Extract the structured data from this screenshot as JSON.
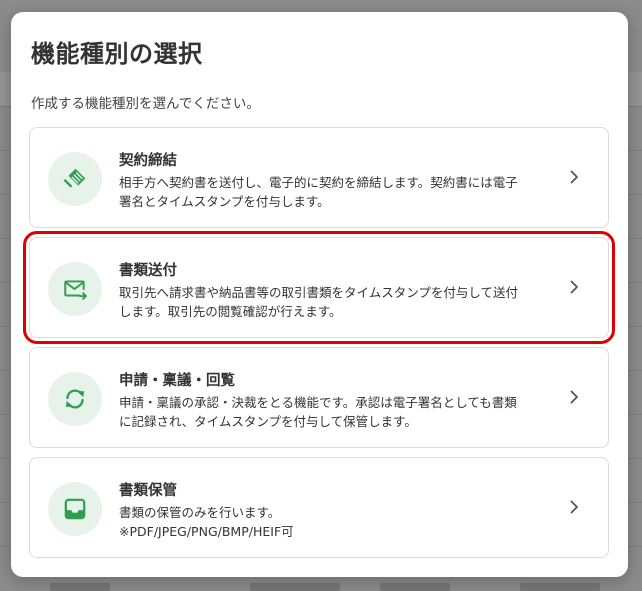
{
  "modal": {
    "title": "機能種別の選択",
    "subtitle": "作成する機能種別を選んでください。"
  },
  "options": [
    {
      "title": "契約締結",
      "desc_line1": "相手方へ契約書を送付し、電子的に契約を締結します。契約書には電子",
      "desc_line2": "署名とタイムスタンプを付与します。",
      "icon": "handshake-icon"
    },
    {
      "title": "書類送付",
      "desc_line1": "取引先へ請求書や納品書等の取引書類をタイムスタンプを付与して送付",
      "desc_line2": "します。取引先の閲覧確認が行えます。",
      "icon": "mail-send-icon",
      "selected": true
    },
    {
      "title": "申請・稟議・回覧",
      "desc_line1": "申請・稟議の承認・決裁をとる機能です。承認は電子署名としても書類",
      "desc_line2": "に記録され、タイムスタンプを付与して保管します。",
      "icon": "sync-icon"
    },
    {
      "title": "書類保管",
      "desc_line1": "書類の保管のみを行います。",
      "desc_line2": "※PDF/JPEG/PNG/BMP/HEIF可",
      "icon": "inbox-icon"
    }
  ],
  "colors": {
    "icon_green": "#2e9e4f",
    "icon_bg": "#e7f3ea",
    "highlight": "#e00000"
  }
}
